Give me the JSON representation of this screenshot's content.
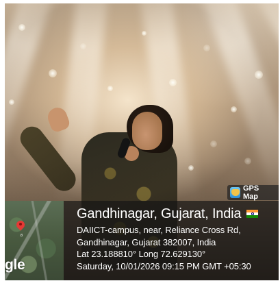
{
  "overlay": {
    "brand_label": "GPS Map",
    "brand_icon": "gps-map-camera-logo-icon",
    "place_title": "Gandhinagar, Gujarat, India",
    "flag_icon": "india-flag-icon",
    "address_line1": "DAIICT-campus, near, Reliance Cross Rd,",
    "address_line2": "Gandhinagar, Gujarat 382007, India",
    "coordinates": "Lat 23.188810° Long 72.629130°",
    "datetime": "Saturday, 10/01/2026 09:15 PM GMT +05:30"
  },
  "minimap": {
    "logo_text": "gle",
    "pin_icon": "map-pin-icon",
    "pin_color": "#e53935",
    "label_text": "ଓ"
  },
  "colors": {
    "panel_bg": "rgba(20,20,20,0.68)",
    "text": "#ffffff"
  }
}
